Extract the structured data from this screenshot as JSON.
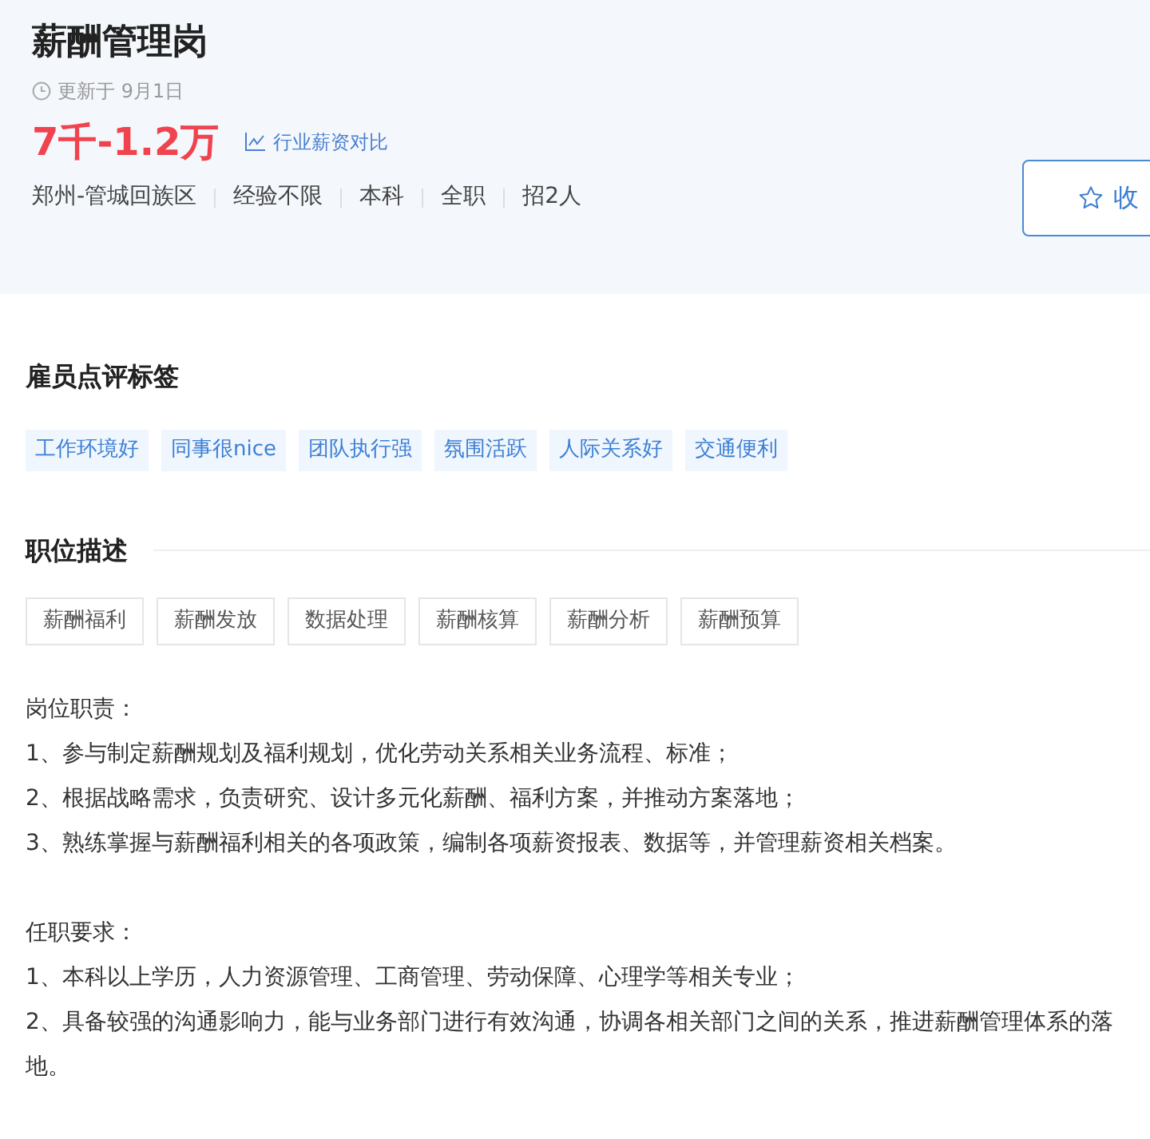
{
  "job": {
    "title": "薪酬管理岗",
    "updated": "更新于 9月1日",
    "salary": "7千-1.2万",
    "compare_link": "行业薪资对比",
    "facts": [
      "郑州-管城回族区",
      "经验不限",
      "本科",
      "全职",
      "招2人"
    ],
    "favorite_button": "收"
  },
  "review_tags": {
    "heading": "雇员点评标签",
    "tags": [
      "工作环境好",
      "同事很nice",
      "团队执行强",
      "氛围活跃",
      "人际关系好",
      "交通便利"
    ]
  },
  "description": {
    "heading": "职位描述",
    "skills": [
      "薪酬福利",
      "薪酬发放",
      "数据处理",
      "薪酬核算",
      "薪酬分析",
      "薪酬预算"
    ],
    "paragraphs": [
      [
        "岗位职责：",
        "1、参与制定薪酬规划及福利规划，优化劳动关系相关业务流程、标准；",
        "2、根据战略需求，负责研究、设计多元化薪酬、福利方案，并推动方案落地；",
        "3、熟练掌握与薪酬福利相关的各项政策，编制各项薪资报表、数据等，并管理薪资相关档案。"
      ],
      [
        "任职要求：",
        "1、本科以上学历，人力资源管理、工商管理、劳动保障、心理学等相关专业；",
        "2、具备较强的沟通影响力，能与业务部门进行有效沟通，协调各相关部门之间的关系，推进薪酬管理体系的落地。"
      ]
    ]
  }
}
